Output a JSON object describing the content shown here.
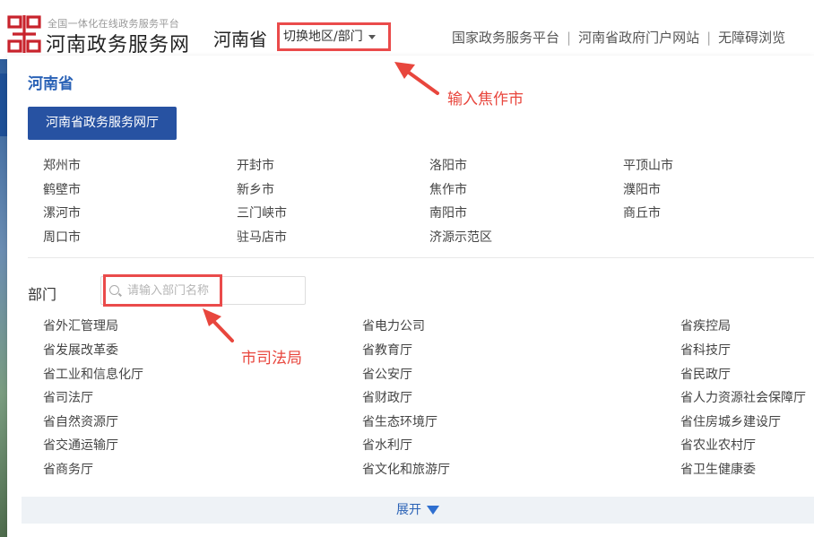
{
  "header": {
    "logo_subtitle": "全国一体化在线政务服务平台",
    "logo_title": "河南政务服务网",
    "province": "河南省",
    "switch_label": "切换地区/部门",
    "links": [
      "国家政务服务平台",
      "河南省政府门户网站",
      "无障碍浏览"
    ]
  },
  "region": {
    "heading": "河南省",
    "hall_button": "河南省政务服务网厅",
    "cities": [
      [
        "郑州市",
        "开封市",
        "洛阳市",
        "平顶山市"
      ],
      [
        "鹤壁市",
        "新乡市",
        "焦作市",
        "濮阳市"
      ],
      [
        "漯河市",
        "三门峡市",
        "南阳市",
        "商丘市"
      ],
      [
        "周口市",
        "驻马店市",
        "济源示范区"
      ]
    ]
  },
  "departments": {
    "label": "部门",
    "search_placeholder": "请输入部门名称",
    "items": [
      [
        "省外汇管理局",
        "省电力公司",
        "省疾控局"
      ],
      [
        "省发展改革委",
        "省教育厅",
        "省科技厅"
      ],
      [
        "省工业和信息化厅",
        "省公安厅",
        "省民政厅"
      ],
      [
        "省司法厅",
        "省财政厅",
        "省人力资源社会保障厅"
      ],
      [
        "省自然资源厅",
        "省生态环境厅",
        "省住房城乡建设厅"
      ],
      [
        "省交通运输厅",
        "省水利厅",
        "省农业农村厅"
      ],
      [
        "省商务厅",
        "省文化和旅游厅",
        "省卫生健康委"
      ]
    ],
    "expand_label": "展开"
  },
  "annotations": {
    "note_region": "输入焦作市",
    "note_dept": "市司法局",
    "color": "#e8463d"
  },
  "colors": {
    "accent": "#2a62b6",
    "button": "#2752a2",
    "logo": "#c8232c"
  }
}
